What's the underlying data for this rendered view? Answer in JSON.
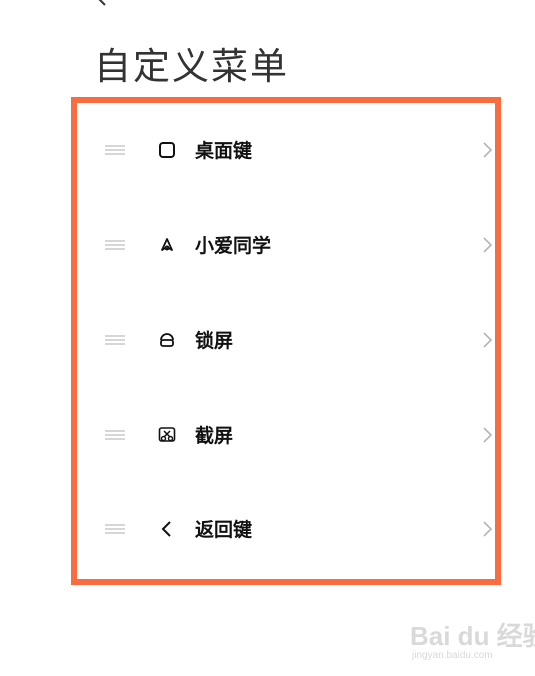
{
  "header": {
    "back_icon": "chevron-left-icon",
    "title": "自定义菜单"
  },
  "menu": {
    "highlight_color": "#f96c3f",
    "items": [
      {
        "label": "桌面键",
        "icon": "square-icon"
      },
      {
        "label": "小爱同学",
        "icon": "xiaoai-icon"
      },
      {
        "label": "锁屏",
        "icon": "lock-icon"
      },
      {
        "label": "截屏",
        "icon": "screenshot-icon"
      },
      {
        "label": "返回键",
        "icon": "chevron-left-icon"
      }
    ]
  },
  "watermark": {
    "logo": "Bai du 经验",
    "url": "jingyan.baidu.com"
  }
}
